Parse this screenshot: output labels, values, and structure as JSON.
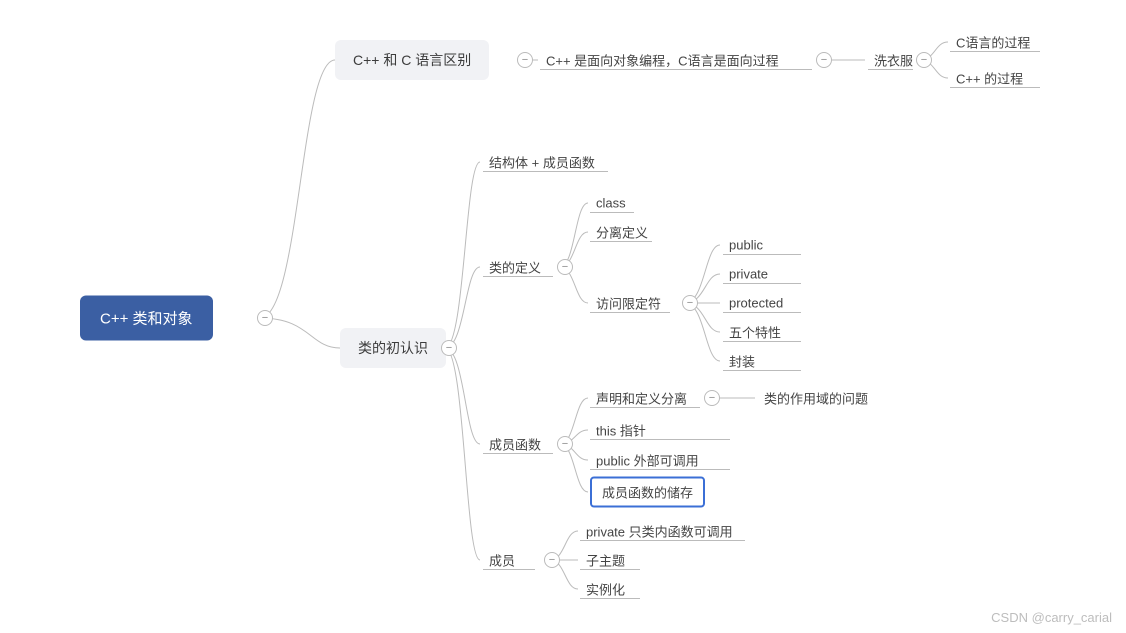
{
  "root": {
    "label": "C++ 类和对象"
  },
  "branch_a": {
    "label": "C++ 和 C 语言区别",
    "note": "C++ 是面向对象编程，C语言是面向过程",
    "sub": {
      "label": "洗衣服"
    },
    "leaves": [
      "C语言的过程",
      "C++ 的过程"
    ]
  },
  "branch_b": {
    "label": "类的初认识",
    "n1": {
      "label": "结构体 + 成员函数"
    },
    "n2": {
      "label": "类的定义",
      "items": [
        "class",
        "分离定义"
      ],
      "sub": {
        "label": "访问限定符",
        "items": [
          "public",
          "private",
          "protected",
          "五个特性",
          "封装"
        ]
      }
    },
    "n3": {
      "label": "成员函数",
      "items": [
        "声明和定义分离",
        "this 指针",
        "public 外部可调用",
        "成员函数的储存"
      ],
      "sub_note": "类的作用域的问题"
    },
    "n4": {
      "label": "成员",
      "items": [
        "private 只类内函数可调用",
        "子主题",
        "实例化"
      ]
    }
  },
  "watermark": "CSDN @carry_carial",
  "chart_data": {
    "type": "mindmap",
    "root": "C++ 类和对象",
    "children": [
      {
        "label": "C++ 和 C 语言区别",
        "children": [
          {
            "label": "C++ 是面向对象编程，C语言是面向过程",
            "children": [
              {
                "label": "洗衣服",
                "children": [
                  {
                    "label": "C语言的过程"
                  },
                  {
                    "label": "C++ 的过程"
                  }
                ]
              }
            ]
          }
        ]
      },
      {
        "label": "类的初认识",
        "children": [
          {
            "label": "结构体 + 成员函数"
          },
          {
            "label": "类的定义",
            "children": [
              {
                "label": "class"
              },
              {
                "label": "分离定义"
              },
              {
                "label": "访问限定符",
                "children": [
                  {
                    "label": "public"
                  },
                  {
                    "label": "private"
                  },
                  {
                    "label": "protected"
                  },
                  {
                    "label": "五个特性"
                  },
                  {
                    "label": "封装"
                  }
                ]
              }
            ]
          },
          {
            "label": "成员函数",
            "children": [
              {
                "label": "声明和定义分离",
                "children": [
                  {
                    "label": "类的作用域的问题"
                  }
                ]
              },
              {
                "label": "this 指针"
              },
              {
                "label": "public 外部可调用"
              },
              {
                "label": "成员函数的储存"
              }
            ]
          },
          {
            "label": "成员",
            "children": [
              {
                "label": "private 只类内函数可调用"
              },
              {
                "label": "子主题"
              },
              {
                "label": "实例化"
              }
            ]
          }
        ]
      }
    ]
  }
}
